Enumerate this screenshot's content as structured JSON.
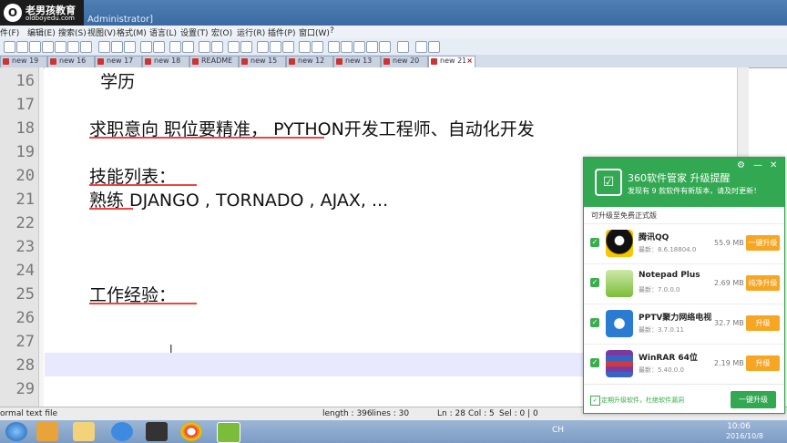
{
  "brand": {
    "logo": "O",
    "name": "老男孩教育",
    "url": "oldboyedu.com"
  },
  "window": {
    "title": "Administrator]"
  },
  "menu": [
    "件(F)",
    "编辑(E)",
    "搜索(S)",
    "视图(V)",
    "格式(M)",
    "语言(L)",
    "设置(T)",
    "宏(O)",
    "运行(R)",
    "插件(P)",
    "窗口(W)",
    "?"
  ],
  "tabs": [
    {
      "label": "new 19"
    },
    {
      "label": "new 16"
    },
    {
      "label": "new 17"
    },
    {
      "label": "new 18"
    },
    {
      "label": "README"
    },
    {
      "label": "new 15"
    },
    {
      "label": "new 12"
    },
    {
      "label": "new 13"
    },
    {
      "label": "new 20"
    },
    {
      "label": "new 21",
      "active": true
    }
  ],
  "editor": {
    "line_numbers": [
      "16",
      "17",
      "18",
      "19",
      "20",
      "21",
      "22",
      "23",
      "24",
      "25",
      "26",
      "27",
      "28",
      "29"
    ],
    "lines": [
      {
        "text": "  学历",
        "mono": false
      },
      {
        "text": "",
        "mono": false
      },
      {
        "text": "求职意向 职位要精准， PYTHON开发工程师、自动化开发",
        "mono": false
      },
      {
        "text": "",
        "mono": false
      },
      {
        "text": "技能列表：",
        "mono": false
      },
      {
        "text": "熟练 DJANGO , TORNADO , AJAX, ...",
        "mono": false
      },
      {
        "text": "",
        "mono": false
      },
      {
        "text": "",
        "mono": false
      },
      {
        "text": "",
        "mono": false
      },
      {
        "text": "工作经验：",
        "mono": false
      },
      {
        "text": "",
        "mono": false
      },
      {
        "text": "",
        "mono": false
      },
      {
        "text": "",
        "mono": false
      },
      {
        "text": "",
        "mono": false
      }
    ]
  },
  "status": {
    "filetype": "ormal text file",
    "length": "length : 396",
    "lines": "lines : 30",
    "ln": "Ln : 28",
    "col": "Col : 5",
    "sel": "Sel : 0 | 0"
  },
  "taskbar": {
    "lang": "CH",
    "time": "10:06",
    "date": "2016/10/8"
  },
  "popup": {
    "logo": "☑",
    "title": "360软件管家 升级提醒",
    "subtitle": "发现有 9 款软件有新版本，请及时更新！",
    "section": "可升级至免费正式版",
    "items": [
      {
        "name": "腾讯QQ",
        "version": "最新：8.6.18804.0",
        "size": "55.9 MB",
        "button": "一键升级",
        "icon_color": "#111"
      },
      {
        "name": "Notepad Plus",
        "version": "最新：7.0.0.0",
        "size": "2.69 MB",
        "button": "纯净升级",
        "icon_color": "#7bbd3a"
      },
      {
        "name": "PPTV聚力网络电视",
        "version": "最新：3.7.0.11",
        "size": "32.7 MB",
        "button": "升级",
        "icon_color": "#2a7bd2"
      },
      {
        "name": "WinRAR 64位",
        "version": "最新：5.40.0.0",
        "size": "2.19 MB",
        "button": "升级",
        "icon_color": "#7a3aa0"
      }
    ],
    "footer_text": "定期升级软件，杜绝软件漏洞",
    "upgrade_all": "一键升级"
  }
}
